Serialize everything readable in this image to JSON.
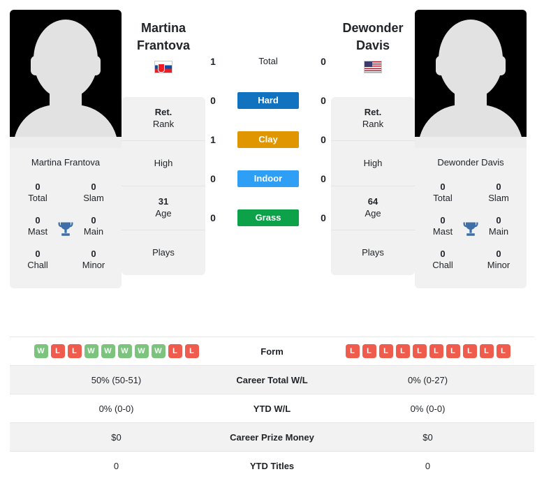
{
  "players": {
    "left": {
      "first_name": "Martina",
      "last_name": "Frantova",
      "full_name": "Martina Frantova",
      "flag_icon": "flag-slovakia-icon",
      "flag_name": "Slovakia",
      "avatar_icon": "player-silhouette-icon",
      "stats": {
        "rank_value": "Ret.",
        "rank_label": "Rank",
        "high_label": "High",
        "high_value": "",
        "age_value": "31",
        "age_label": "Age",
        "plays_label": "Plays",
        "plays_value": ""
      },
      "titles": {
        "trophy_icon": "trophy-icon",
        "cells": [
          {
            "num": "0",
            "label": "Total"
          },
          {
            "num": "0",
            "label": "Slam"
          },
          {
            "num": "0",
            "label": "Mast"
          },
          {
            "num": "0",
            "label": "Main"
          },
          {
            "num": "0",
            "label": "Chall"
          },
          {
            "num": "0",
            "label": "Minor"
          }
        ]
      },
      "form": [
        "W",
        "L",
        "L",
        "W",
        "W",
        "W",
        "W",
        "W",
        "L",
        "L"
      ]
    },
    "right": {
      "first_name": "Dewonder",
      "last_name": "Davis",
      "full_name": "Dewonder Davis",
      "flag_icon": "flag-usa-icon",
      "flag_name": "United States",
      "avatar_icon": "player-silhouette-icon",
      "stats": {
        "rank_value": "Ret.",
        "rank_label": "Rank",
        "high_label": "High",
        "high_value": "",
        "age_value": "64",
        "age_label": "Age",
        "plays_label": "Plays",
        "plays_value": ""
      },
      "titles": {
        "trophy_icon": "trophy-icon",
        "cells": [
          {
            "num": "0",
            "label": "Total"
          },
          {
            "num": "0",
            "label": "Slam"
          },
          {
            "num": "0",
            "label": "Mast"
          },
          {
            "num": "0",
            "label": "Main"
          },
          {
            "num": "0",
            "label": "Chall"
          },
          {
            "num": "0",
            "label": "Minor"
          }
        ]
      },
      "form": [
        "L",
        "L",
        "L",
        "L",
        "L",
        "L",
        "L",
        "L",
        "L",
        "L"
      ]
    }
  },
  "surfaces": [
    {
      "label": "Total",
      "left": "1",
      "right": "0",
      "color": "transparent",
      "plain": true
    },
    {
      "label": "Hard",
      "left": "0",
      "right": "0",
      "color": "#1173c0",
      "plain": false
    },
    {
      "label": "Clay",
      "left": "1",
      "right": "0",
      "color": "#e09600",
      "plain": false
    },
    {
      "label": "Indoor",
      "left": "0",
      "right": "0",
      "color": "#2f9ef5",
      "plain": false
    },
    {
      "label": "Grass",
      "left": "0",
      "right": "0",
      "color": "#0da14a",
      "plain": false
    }
  ],
  "comparison_rows": [
    {
      "label": "Form",
      "left": "",
      "right": "",
      "type": "form",
      "shaded": false
    },
    {
      "label": "Career Total W/L",
      "left": "50% (50-51)",
      "right": "0% (0-27)",
      "type": "text",
      "shaded": true
    },
    {
      "label": "YTD W/L",
      "left": "0% (0-0)",
      "right": "0% (0-0)",
      "type": "text",
      "shaded": false
    },
    {
      "label": "Career Prize Money",
      "left": "$0",
      "right": "$0",
      "type": "text",
      "shaded": true
    },
    {
      "label": "YTD Titles",
      "left": "0",
      "right": "0",
      "type": "text",
      "shaded": false
    }
  ],
  "colors": {
    "hard": "#1173c0",
    "clay": "#e09600",
    "indoor": "#2f9ef5",
    "grass": "#0da14a",
    "win": "#7cc47e",
    "loss": "#ef5b4c",
    "trophy": "#3f6fa8",
    "card_bg": "#f1f1f1"
  }
}
